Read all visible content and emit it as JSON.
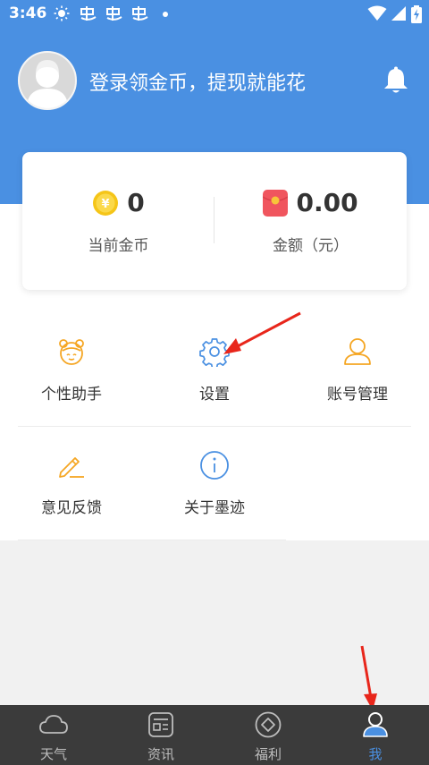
{
  "status_bar": {
    "time": "3:46"
  },
  "header": {
    "login_prompt": "登录领金币，提现就能花"
  },
  "coin_card": {
    "coins": {
      "value": "0",
      "label": "当前金币"
    },
    "amount": {
      "value": "0.00",
      "label": "金额（元）"
    }
  },
  "menu": {
    "items": [
      {
        "label": "个性助手",
        "icon": "avatar-face-icon"
      },
      {
        "label": "设置",
        "icon": "gear-icon"
      },
      {
        "label": "账号管理",
        "icon": "person-icon"
      },
      {
        "label": "意见反馈",
        "icon": "pencil-icon"
      },
      {
        "label": "关于墨迹",
        "icon": "info-icon"
      }
    ]
  },
  "tabbar": {
    "tabs": [
      {
        "label": "天气",
        "icon": "cloud-icon",
        "active": false
      },
      {
        "label": "资讯",
        "icon": "news-icon",
        "active": false
      },
      {
        "label": "福利",
        "icon": "diamond-icon",
        "active": false
      },
      {
        "label": "我",
        "icon": "user-icon",
        "active": true
      }
    ]
  },
  "colors": {
    "header_blue": "#4a90e2",
    "accent_orange": "#f5a623",
    "tab_active": "#4a90e2",
    "tabbar_bg": "#3b3b3b",
    "arrow_red": "#e8261b"
  }
}
